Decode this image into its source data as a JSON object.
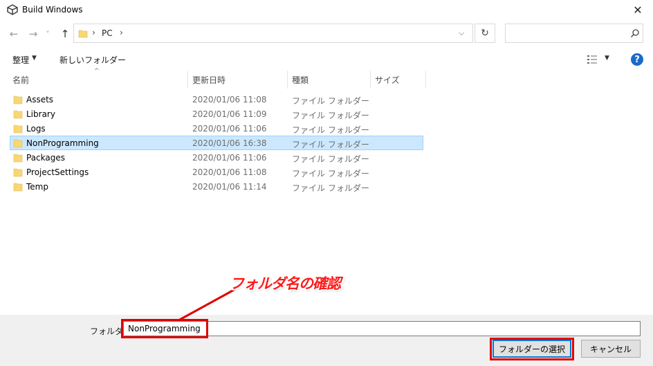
{
  "window": {
    "title": "Build Windows",
    "close_glyph": "✕"
  },
  "nav": {
    "back_glyph": "←",
    "forward_glyph": "→",
    "recent_glyph": "˅",
    "up_glyph": "↑",
    "address": {
      "separator": "›",
      "location": "PC",
      "dropdown_glyph": "⌵"
    },
    "refresh_glyph": "↻",
    "search": {
      "placeholder": ""
    }
  },
  "toolbar": {
    "organize_label": "整理",
    "organize_dd": "▼",
    "new_folder_label": "新しいフォルダー",
    "view_dd": "▼",
    "help_label": "?"
  },
  "columns": {
    "name": "名前",
    "modified": "更新日時",
    "type": "種類",
    "size": "サイズ",
    "sort_glyph": "^"
  },
  "files": [
    {
      "name": "Assets",
      "modified": "2020/01/06 11:08",
      "type": "ファイル フォルダー",
      "selected": false
    },
    {
      "name": "Library",
      "modified": "2020/01/06 11:09",
      "type": "ファイル フォルダー",
      "selected": false
    },
    {
      "name": "Logs",
      "modified": "2020/01/06 11:06",
      "type": "ファイル フォルダー",
      "selected": false
    },
    {
      "name": "NonProgramming",
      "modified": "2020/01/06 16:38",
      "type": "ファイル フォルダー",
      "selected": true
    },
    {
      "name": "Packages",
      "modified": "2020/01/06 11:06",
      "type": "ファイル フォルダー",
      "selected": false
    },
    {
      "name": "ProjectSettings",
      "modified": "2020/01/06 11:08",
      "type": "ファイル フォルダー",
      "selected": false
    },
    {
      "name": "Temp",
      "modified": "2020/01/06 11:14",
      "type": "ファイル フォルダー",
      "selected": false
    }
  ],
  "footer": {
    "folder_label": "フォルダー:",
    "folder_value": "NonProgramming",
    "select_button": "フォルダーの選択",
    "cancel_button": "キャンセル"
  },
  "annotation": {
    "text": "フォルダ名の確認",
    "color": "#e00000"
  },
  "colors": {
    "selection_bg": "#cce8ff",
    "selection_border": "#99d1ff",
    "folder_yellow": "#f8d775",
    "accent": "#0078d7"
  }
}
